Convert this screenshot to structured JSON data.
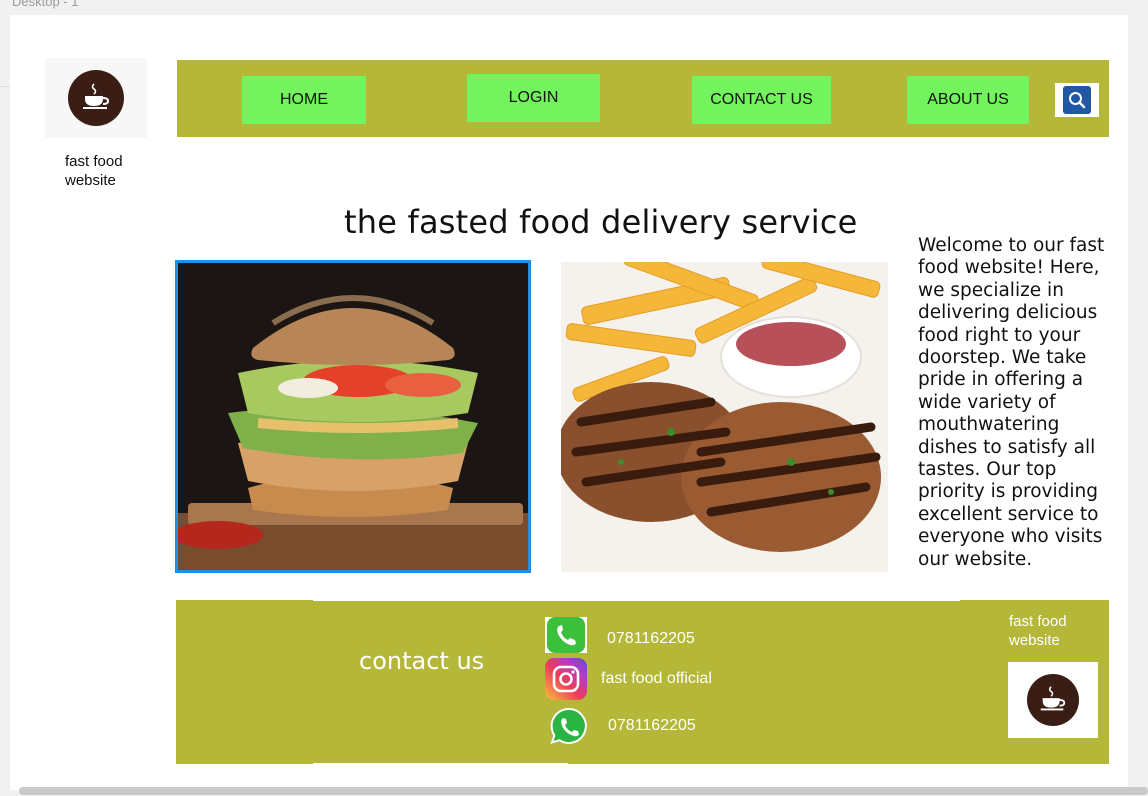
{
  "frame_label": "Desktop - 1",
  "brand": {
    "name": "fast food website",
    "icon": "coffee-cup-icon"
  },
  "nav": {
    "items": [
      {
        "label": "HOME"
      },
      {
        "label": "LOGIN"
      },
      {
        "label": "CONTACT US"
      },
      {
        "label": "ABOUT US"
      }
    ],
    "search_icon": "search-icon"
  },
  "main": {
    "headline": "the fasted food delivery service",
    "welcome_text": "Welcome to our fast food website! Here, we specialize in delivering delicious food right to your doorstep. We take pride in offering a wide variety of mouthwatering dishes to satisfy all tastes. Our top priority is providing excellent service to everyone who visits our website.",
    "images": [
      {
        "name": "burger-image"
      },
      {
        "name": "grilled-patties-fries-image"
      }
    ]
  },
  "footer": {
    "contact_title": "contact us",
    "contacts": [
      {
        "icon": "phone-icon",
        "text": "0781162205"
      },
      {
        "icon": "instagram-icon",
        "text": "fast food official"
      },
      {
        "icon": "whatsapp-icon",
        "text": "0781162205"
      }
    ],
    "brand": "fast food website"
  },
  "colors": {
    "bar": "#b5b738",
    "button": "#73f35d",
    "accent_border": "#1e90ea"
  }
}
